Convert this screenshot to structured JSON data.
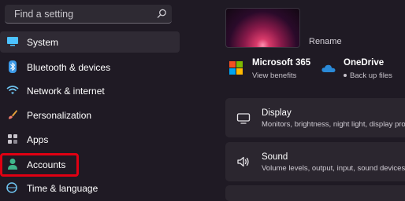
{
  "search": {
    "placeholder": "Find a setting",
    "icon": "search-icon"
  },
  "sidebar": {
    "items": [
      {
        "label": "System",
        "icon": "monitor-icon"
      },
      {
        "label": "Bluetooth & devices",
        "icon": "bluetooth-icon"
      },
      {
        "label": "Network & internet",
        "icon": "wifi-icon"
      },
      {
        "label": "Personalization",
        "icon": "brush-icon"
      },
      {
        "label": "Apps",
        "icon": "apps-icon"
      },
      {
        "label": "Accounts",
        "icon": "person-icon"
      },
      {
        "label": "Time & language",
        "icon": "globe-clock-icon"
      }
    ],
    "selected": "System",
    "highlighted": "Accounts",
    "highlight_color": "#e00012"
  },
  "header": {
    "rename_label": "Rename",
    "apps": [
      {
        "title": "Microsoft 365",
        "subtitle": "View benefits",
        "icon": "microsoft-logo-icon"
      },
      {
        "title": "OneDrive",
        "subtitle": "Back up files",
        "icon": "onedrive-cloud-icon"
      }
    ]
  },
  "cards": [
    {
      "title": "Display",
      "subtitle": "Monitors, brightness, night light, display profile",
      "icon": "display-icon"
    },
    {
      "title": "Sound",
      "subtitle": "Volume levels, output, input, sound devices",
      "icon": "speaker-icon"
    }
  ],
  "colors": {
    "background": "#1f1a24",
    "card": "#2b262f",
    "accent": "#4cc2ff"
  }
}
